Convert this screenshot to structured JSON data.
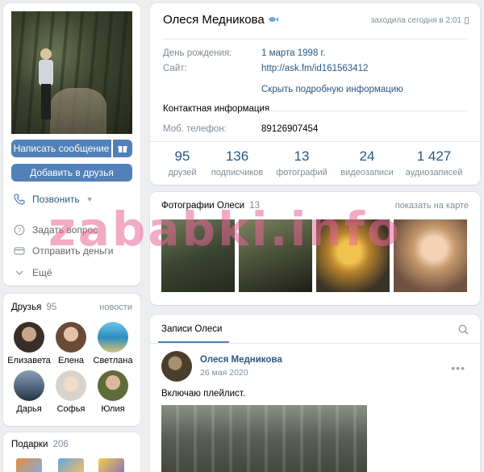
{
  "profile": {
    "name": "Олеся Медникова",
    "last_seen": "заходила сегодня в 2:01",
    "info_rows": [
      {
        "label": "День рождения:",
        "value": "1 марта 1998 г."
      },
      {
        "label": "Сайт:",
        "value": "http://ask.fm/id161563412"
      }
    ],
    "hide_info": "Скрыть подробную информацию",
    "contact_heading": "Контактная информация",
    "phone_label": "Моб. телефон:",
    "phone_value": "89126907454"
  },
  "stats": [
    {
      "num": "95",
      "cap": "друзей"
    },
    {
      "num": "136",
      "cap": "подписчиков"
    },
    {
      "num": "13",
      "cap": "фотографий"
    },
    {
      "num": "24",
      "cap": "видеозаписи"
    },
    {
      "num": "1 427",
      "cap": "аудиозаписей"
    }
  ],
  "actions": {
    "message": "Написать сообщение",
    "add_friend": "Добавить в друзья",
    "call": "Позвонить",
    "ask": "Задать вопрос",
    "send_money": "Отправить деньги",
    "more": "Ещё"
  },
  "friends": {
    "title": "Друзья",
    "count": "95",
    "news": "новости",
    "items": [
      {
        "name": "Елизавета"
      },
      {
        "name": "Елена"
      },
      {
        "name": "Светлана"
      },
      {
        "name": "Дарья"
      },
      {
        "name": "Софья"
      },
      {
        "name": "Юлия"
      }
    ]
  },
  "gifts": {
    "title": "Подарки",
    "count": "206"
  },
  "photos": {
    "title": "Фотографии Олеси",
    "count": "13",
    "map_link": "показать на карте"
  },
  "wall": {
    "tab": "Записи Олеси",
    "post_author": "Олеся Медникова",
    "post_date": "26 мая 2020",
    "post_text": "Включаю плейлист."
  },
  "watermark": "zababki.info",
  "colors": {
    "accent": "#5181b8",
    "link": "#2a5885",
    "muted": "#818c99",
    "background": "#edeef0"
  }
}
